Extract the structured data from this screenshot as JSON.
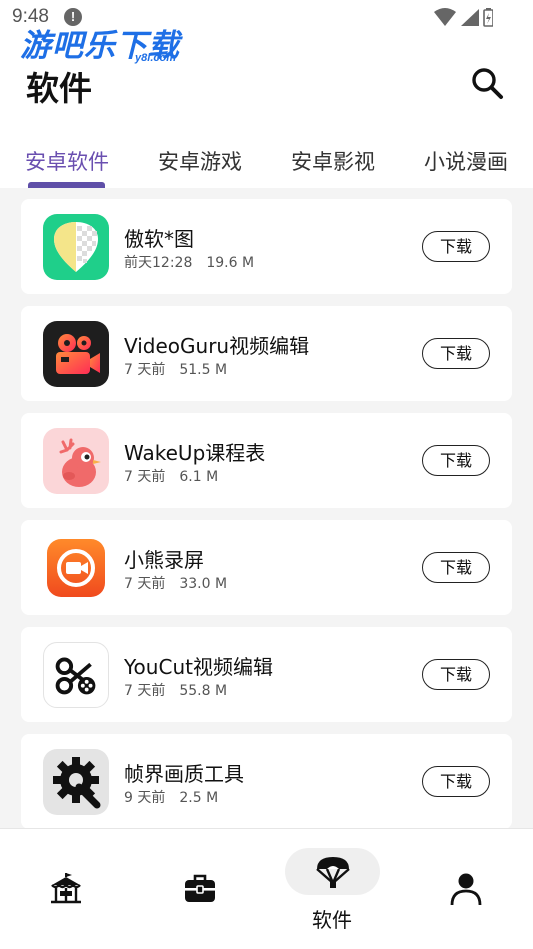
{
  "status_bar": {
    "time": "9:48",
    "notification_glyph": "!"
  },
  "watermark": {
    "text": "游吧乐下载",
    "sub": "y8l.com"
  },
  "header": {
    "title": "软件"
  },
  "tabs": [
    {
      "label": "安卓软件",
      "active": true
    },
    {
      "label": "安卓游戏",
      "active": false
    },
    {
      "label": "安卓影视",
      "active": false
    },
    {
      "label": "小说漫画",
      "active": false
    }
  ],
  "apps": [
    {
      "name": "傲软*图",
      "time": "前天12:28",
      "size": "19.6 M",
      "button": "下载",
      "icon": "aoruan-cutout-icon"
    },
    {
      "name": "VideoGuru视频编辑",
      "time": "7 天前",
      "size": "51.5 M",
      "button": "下载",
      "icon": "videoguru-camera-icon"
    },
    {
      "name": "WakeUp课程表",
      "time": "7 天前",
      "size": "6.1 M",
      "button": "下载",
      "icon": "wakeup-bird-icon"
    },
    {
      "name": "小熊录屏",
      "time": "7 天前",
      "size": "33.0 M",
      "button": "下载",
      "icon": "xiaoxiong-record-icon"
    },
    {
      "name": "YouCut视频编辑",
      "time": "7 天前",
      "size": "55.8 M",
      "button": "下载",
      "icon": "youcut-scissors-icon"
    },
    {
      "name": "帧界画质工具",
      "time": "9 天前",
      "size": "2.5 M",
      "button": "下载",
      "icon": "gear-tool-icon"
    }
  ],
  "bottom_nav": {
    "items": [
      {
        "icon": "carousel-icon"
      },
      {
        "icon": "toolbox-icon"
      },
      {
        "icon": "parachute-icon",
        "label": "软件",
        "active": true
      },
      {
        "icon": "person-icon"
      }
    ]
  },
  "colors": {
    "accent": "#5f4fa8",
    "list_background": "#f4f4f4",
    "watermark": "#1e6fe6"
  }
}
